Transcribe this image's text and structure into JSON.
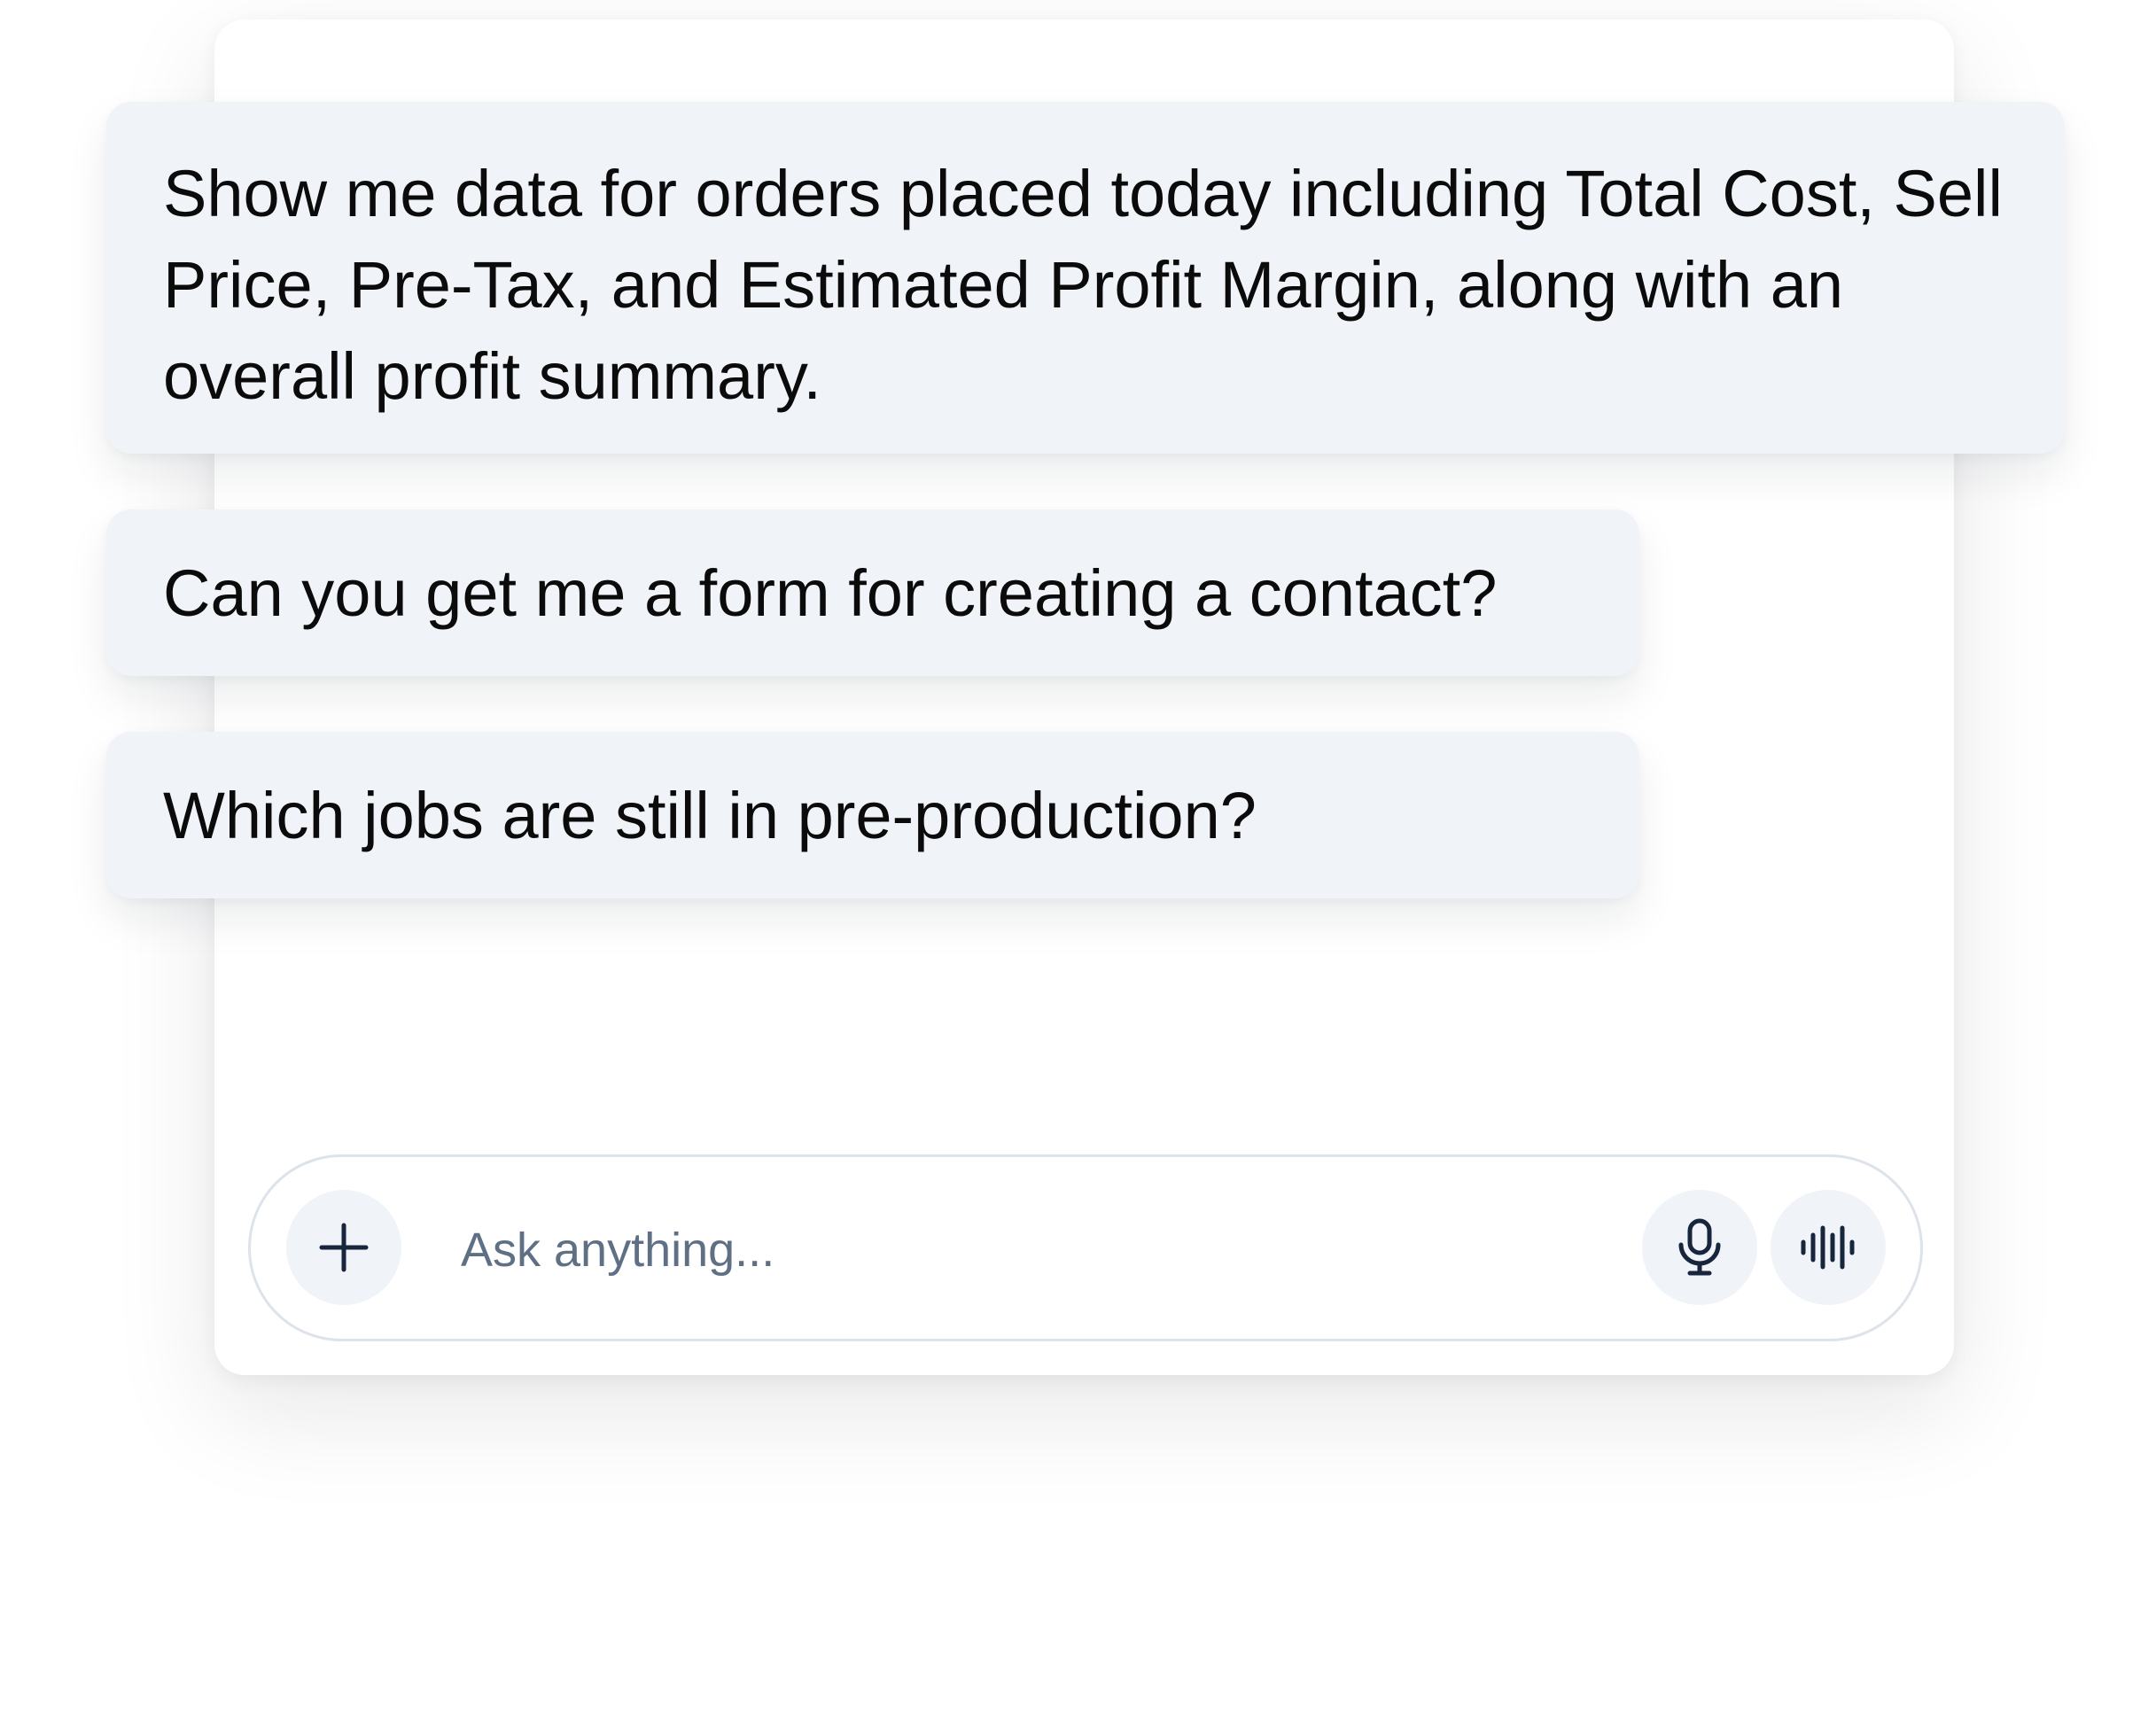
{
  "messages": [
    {
      "text": "Show me data for orders placed today including Total Cost, Sell Price, Pre-Tax, and Estimated Profit Margin, along with an overall profit summary."
    },
    {
      "text": "Can you get me a form for creating a contact?"
    },
    {
      "text": "Which jobs are still in pre-production?"
    }
  ],
  "composer": {
    "placeholder": "Ask anything...",
    "icons": {
      "add": "plus-icon",
      "voice_input": "microphone-icon",
      "voice_mode": "audio-waveform-icon"
    }
  },
  "colors": {
    "bubble_background": "#f0f3f7",
    "icon": "#17253d",
    "placeholder_text": "#5f6f84",
    "composer_border": "#dde3ea"
  }
}
